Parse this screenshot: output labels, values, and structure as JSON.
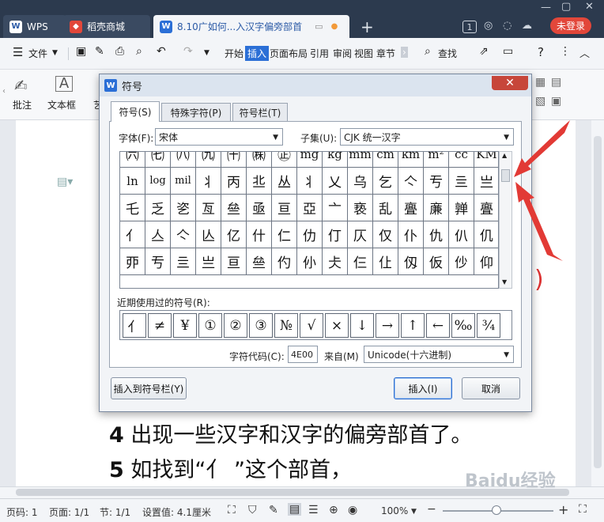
{
  "tabs": [
    {
      "label": "WPS"
    },
    {
      "label": "稻壳商城"
    },
    {
      "label": "8.10广如何...入汉字偏旁部首"
    }
  ],
  "titlebar": {
    "badge": "1",
    "login": "未登录"
  },
  "menu": {
    "file": "文件",
    "items": [
      "开始",
      "插入",
      "页面布局",
      "引用",
      "审阅",
      "视图",
      "章节"
    ],
    "search": "查找"
  },
  "ribbon": {
    "annotate": "批注",
    "textbox": "文本框",
    "cut_label": "艺"
  },
  "document": {
    "line1_num": "4",
    "line1_text": "出现一些汉字和汉字的偏旁部首了。",
    "line2_num": "5",
    "line2_text": "如找到“亻 ”这个部首，"
  },
  "dialog": {
    "title": "符号",
    "tabs": [
      "符号(S)",
      "特殊字符(P)",
      "符号栏(T)"
    ],
    "font_label": "字体(F):",
    "font_value": "宋体",
    "subset_label": "子集(U):",
    "subset_value": "CJK 统一汉字",
    "grid_rows": [
      [
        "㈥",
        "㈦",
        "㈧",
        "㈨",
        "㈩",
        "㈱",
        "㊣",
        "mg",
        "kg",
        "mm",
        "cm",
        "km",
        "m²",
        "cc",
        "KM"
      ],
      [
        "ln",
        "log",
        "mil",
        "丬",
        "丙",
        "丠",
        "丛",
        "丬",
        "乂",
        "乌",
        "乞",
        "亽",
        "亐",
        "亖",
        "亗"
      ],
      [
        "乇",
        "乏",
        "乲",
        "亙",
        "亝",
        "亟",
        "亘",
        "亞",
        "亠",
        "亵",
        "乱",
        "亹",
        "亷",
        "亸",
        "亹"
      ],
      [
        "亻",
        "亼",
        "亽",
        "亾",
        "亿",
        "什",
        "仁",
        "仂",
        "仃",
        "仄",
        "仅",
        "仆",
        "仇",
        "仈",
        "仉"
      ],
      [
        "丣",
        "亐",
        "亖",
        "亗",
        "亘",
        "亝",
        "仢",
        "仦",
        "仧",
        "仨",
        "仩",
        "仭",
        "仮",
        "仯",
        "仰"
      ]
    ],
    "recent_label": "近期使用过的符号(R):",
    "recent": [
      "亻",
      "≠",
      "¥",
      "①",
      "②",
      "③",
      "№",
      "√",
      "×",
      "↓",
      "→",
      "↑",
      "←",
      "‰",
      "¾"
    ],
    "code_label": "字符代码(C):",
    "code_value": "4E00",
    "from_label": "来自(M)",
    "from_value": "Unicode(十六进制)",
    "btn_toolbar": "插入到符号栏(Y)",
    "btn_insert": "插入(I)",
    "btn_cancel": "取消"
  },
  "status": {
    "page_code": "页码: 1",
    "page": "页面: 1/1",
    "section": "节: 1/1",
    "setting": "设置值: 4.1厘米",
    "zoom": "100%"
  },
  "watermark": "Baidu经验",
  "accent": "#2b6fd6",
  "arrow_color": "#e23a35"
}
